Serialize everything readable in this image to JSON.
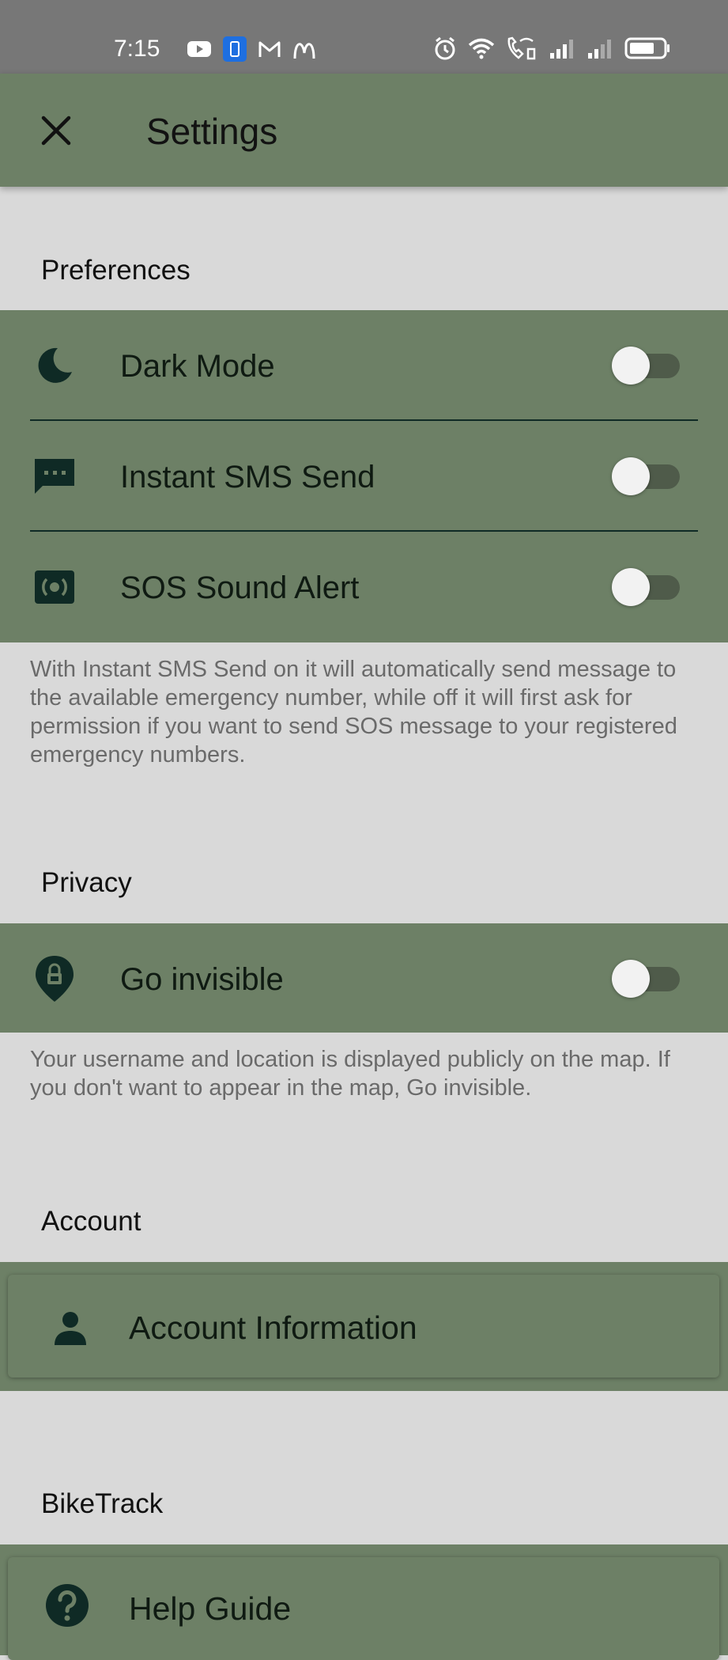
{
  "status_bar": {
    "time": "7:15",
    "left_icons": [
      "youtube-icon",
      "notification-icon",
      "gmail-icon",
      "mcdonalds-icon"
    ],
    "right_icons": [
      "alarm-icon",
      "wifi-icon",
      "wifi-calling-icon",
      "signal-icon",
      "signal-icon-2",
      "battery-icon"
    ]
  },
  "app_bar": {
    "title": "Settings",
    "close_icon": "close-icon"
  },
  "preferences": {
    "header": "Preferences",
    "items": [
      {
        "label": "Dark Mode",
        "icon": "moon-icon",
        "enabled": false
      },
      {
        "label": "Instant SMS Send",
        "icon": "sms-icon",
        "enabled": false
      },
      {
        "label": "SOS Sound Alert",
        "icon": "sound-alert-icon",
        "enabled": false
      }
    ],
    "helper": "With Instant SMS Send on it will automatically send message to the available emergency number, while off it will first ask for permission if you want to send SOS message to your registered emergency numbers."
  },
  "privacy": {
    "header": "Privacy",
    "items": [
      {
        "label": "Go invisible",
        "icon": "location-lock-icon",
        "enabled": false
      }
    ],
    "helper": "Your username and location is displayed publicly on the map. If you don't want to appear in the map, Go invisible."
  },
  "account": {
    "header": "Account",
    "item_label": "Account Information",
    "icon": "person-icon"
  },
  "biketrack": {
    "header": "BikeTrack",
    "item_label": "Help Guide",
    "icon": "help-icon"
  },
  "colors": {
    "status_bar": "#777777",
    "app_bar": "#6d8066",
    "background": "#d9d9d9",
    "icon": "#0f2a25"
  }
}
